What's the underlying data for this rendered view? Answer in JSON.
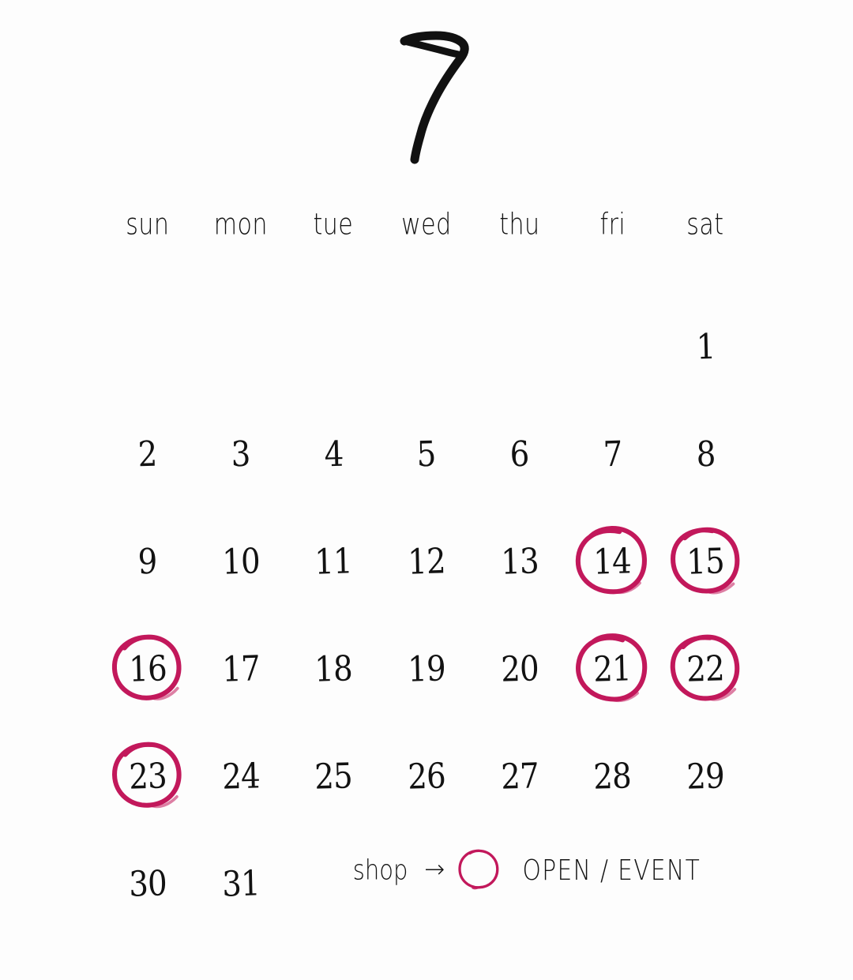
{
  "calendar": {
    "month_number": "7",
    "accent_color": "#C2185B",
    "ink_color": "#121212",
    "background_color": "#ffffff",
    "weekdays": [
      "sun",
      "mon",
      "tue",
      "wed",
      "thu",
      "fri",
      "sat"
    ],
    "weeks": [
      [
        {
          "day": "",
          "circled": false
        },
        {
          "day": "",
          "circled": false
        },
        {
          "day": "",
          "circled": false
        },
        {
          "day": "",
          "circled": false
        },
        {
          "day": "",
          "circled": false
        },
        {
          "day": "",
          "circled": false
        },
        {
          "day": "1",
          "circled": false
        }
      ],
      [
        {
          "day": "2",
          "circled": false
        },
        {
          "day": "3",
          "circled": false
        },
        {
          "day": "4",
          "circled": false
        },
        {
          "day": "5",
          "circled": false
        },
        {
          "day": "6",
          "circled": false
        },
        {
          "day": "7",
          "circled": false
        },
        {
          "day": "8",
          "circled": false
        }
      ],
      [
        {
          "day": "9",
          "circled": false
        },
        {
          "day": "10",
          "circled": false
        },
        {
          "day": "11",
          "circled": false
        },
        {
          "day": "12",
          "circled": false
        },
        {
          "day": "13",
          "circled": false
        },
        {
          "day": "14",
          "circled": true
        },
        {
          "day": "15",
          "circled": true
        }
      ],
      [
        {
          "day": "16",
          "circled": true
        },
        {
          "day": "17",
          "circled": false
        },
        {
          "day": "18",
          "circled": false
        },
        {
          "day": "19",
          "circled": false
        },
        {
          "day": "20",
          "circled": false
        },
        {
          "day": "21",
          "circled": true
        },
        {
          "day": "22",
          "circled": true
        }
      ],
      [
        {
          "day": "23",
          "circled": true
        },
        {
          "day": "24",
          "circled": false
        },
        {
          "day": "25",
          "circled": false
        },
        {
          "day": "26",
          "circled": false
        },
        {
          "day": "27",
          "circled": false
        },
        {
          "day": "28",
          "circled": false
        },
        {
          "day": "29",
          "circled": false
        }
      ],
      [
        {
          "day": "30",
          "circled": false
        },
        {
          "day": "31",
          "circled": false
        },
        {
          "day": "",
          "circled": false
        },
        {
          "day": "",
          "circled": false
        },
        {
          "day": "",
          "circled": false
        },
        {
          "day": "",
          "circled": false
        },
        {
          "day": "",
          "circled": false
        }
      ]
    ],
    "circled_days": [
      "14",
      "15",
      "16",
      "21",
      "22",
      "23"
    ]
  },
  "legend": {
    "shop_label": "shop",
    "arrow": "→",
    "marker_icon": "circle-icon",
    "meaning_label": "OPEN / EVENT"
  }
}
